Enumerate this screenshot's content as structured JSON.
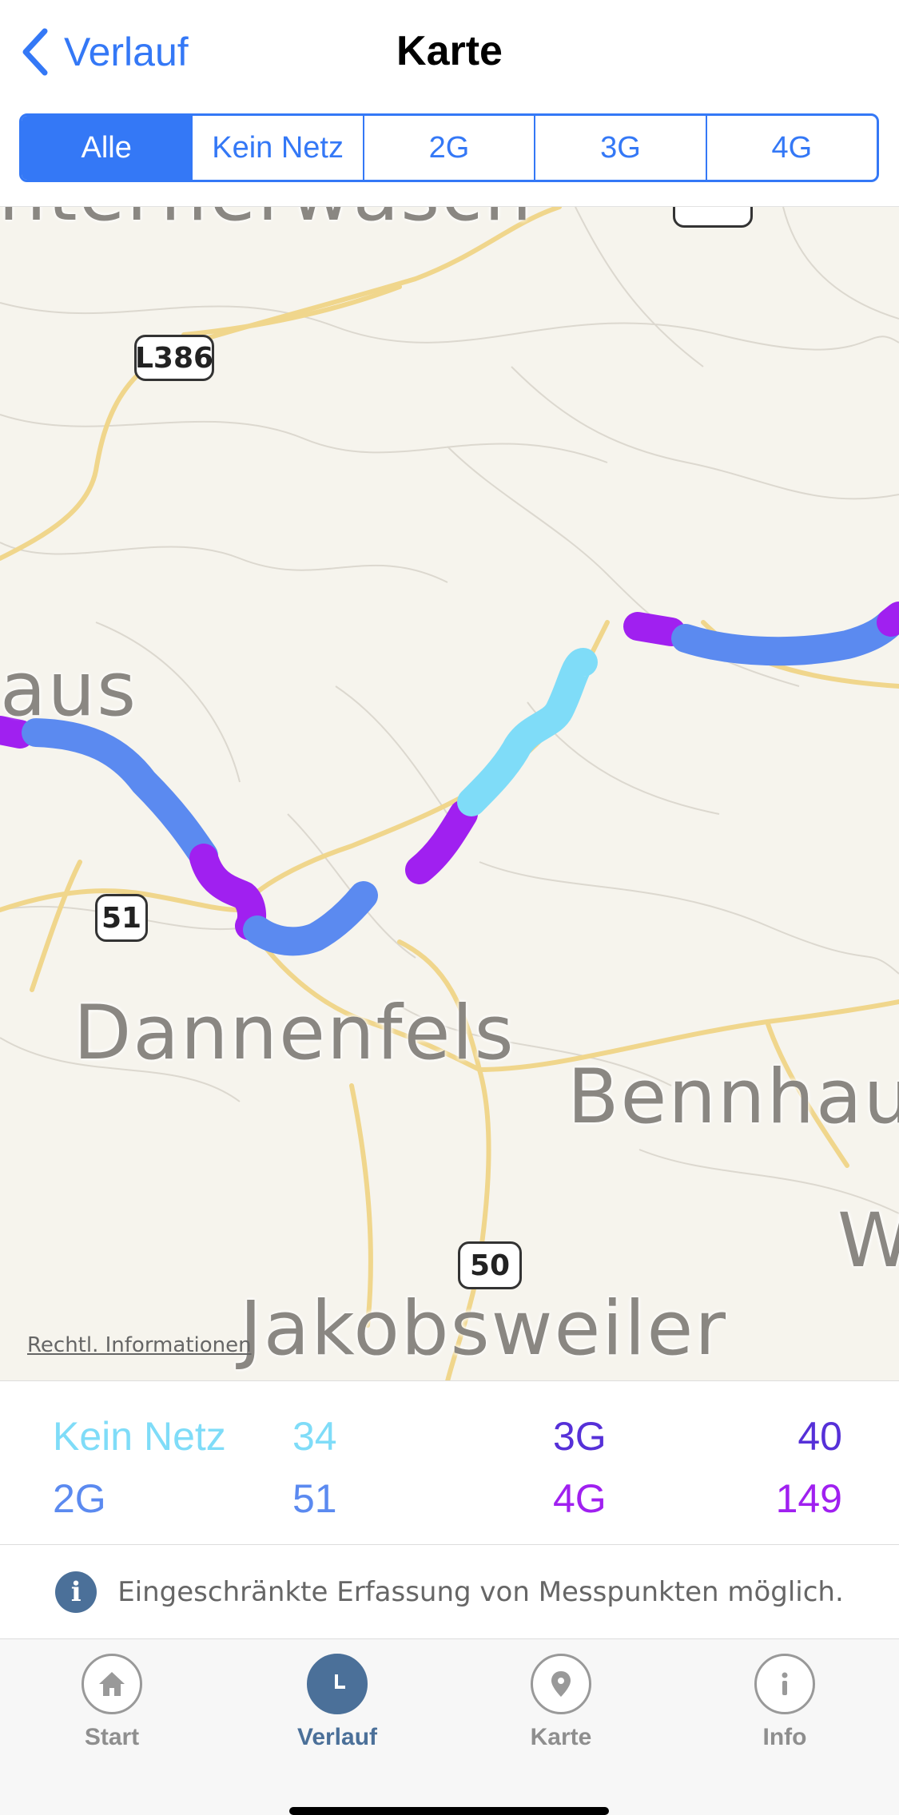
{
  "nav": {
    "back_label": "Verlauf",
    "title": "Karte"
  },
  "filter": {
    "segments": [
      "Alle",
      "Kein Netz",
      "2G",
      "3G",
      "4G"
    ],
    "selected": "Alle"
  },
  "map": {
    "places": [
      "aus",
      "Dannenfels",
      "Bennhau",
      "Jakobsweiler",
      "W",
      "interflerwasch"
    ],
    "road_shields": [
      "L386",
      "51",
      "50"
    ],
    "legal_link": "Rechtl. Informationen"
  },
  "colors": {
    "accent": "#3478f6",
    "kein_netz": "#7fdcf8",
    "g2": "#5b8af0",
    "g3": "#5630d8",
    "g4": "#a020f0",
    "tab_active": "#4b7099"
  },
  "stats": {
    "kein_netz": {
      "label": "Kein Netz",
      "value": "34"
    },
    "g2": {
      "label": "2G",
      "value": "51"
    },
    "g3": {
      "label": "3G",
      "value": "40"
    },
    "g4": {
      "label": "4G",
      "value": "149"
    }
  },
  "info": {
    "icon": "info-icon",
    "text": "Eingeschränkte Erfassung von Messpunkten möglich."
  },
  "tabbar": {
    "tabs": [
      {
        "label": "Start",
        "icon": "home-icon"
      },
      {
        "label": "Verlauf",
        "icon": "clock-icon"
      },
      {
        "label": "Karte",
        "icon": "map-pin-icon"
      },
      {
        "label": "Info",
        "icon": "info-icon"
      }
    ],
    "active": "Verlauf"
  }
}
